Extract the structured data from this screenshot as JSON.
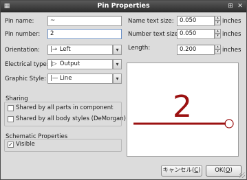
{
  "window": {
    "title": "Pin Properties"
  },
  "left": {
    "pin_name_label": "Pin name:",
    "pin_name_value": "~",
    "pin_number_label": "Pin number:",
    "pin_number_value": "2",
    "orientation_label": "Orientation:",
    "orientation_glyph": "|→",
    "orientation_value": "Left",
    "electrical_type_label": "Electrical type:",
    "electrical_type_glyph": "|▷",
    "electrical_type_value": "Output",
    "graphic_style_label": "Graphic Style:",
    "graphic_style_glyph": "|—",
    "graphic_style_value": "Line"
  },
  "sharing": {
    "title": "Sharing",
    "all_parts_label": "Shared by all parts in component",
    "all_parts_checked": false,
    "all_body_styles_label": "Shared by all body styles (DeMorgan)",
    "all_body_styles_checked": false
  },
  "schematic": {
    "title": "Schematic Properties",
    "visible_label": "Visible",
    "visible_checked": true
  },
  "right": {
    "name_text_size_label": "Name text size:",
    "name_text_size_value": "0.050",
    "name_text_size_unit": "inches",
    "number_text_size_label": "Number text size:",
    "number_text_size_value": "0.050",
    "number_text_size_unit": "inches",
    "length_label": "Length:",
    "length_value": "0.200",
    "length_unit": "inches"
  },
  "preview": {
    "pin_number_text": "2",
    "pin_color": "#9b1111"
  },
  "buttons": {
    "cancel": "キャンセル",
    "cancel_key": "C",
    "ok": "OK",
    "ok_key": "O"
  },
  "icons": {
    "app": "app-icon",
    "menu": "window-menu-icon",
    "close": "close-icon"
  }
}
